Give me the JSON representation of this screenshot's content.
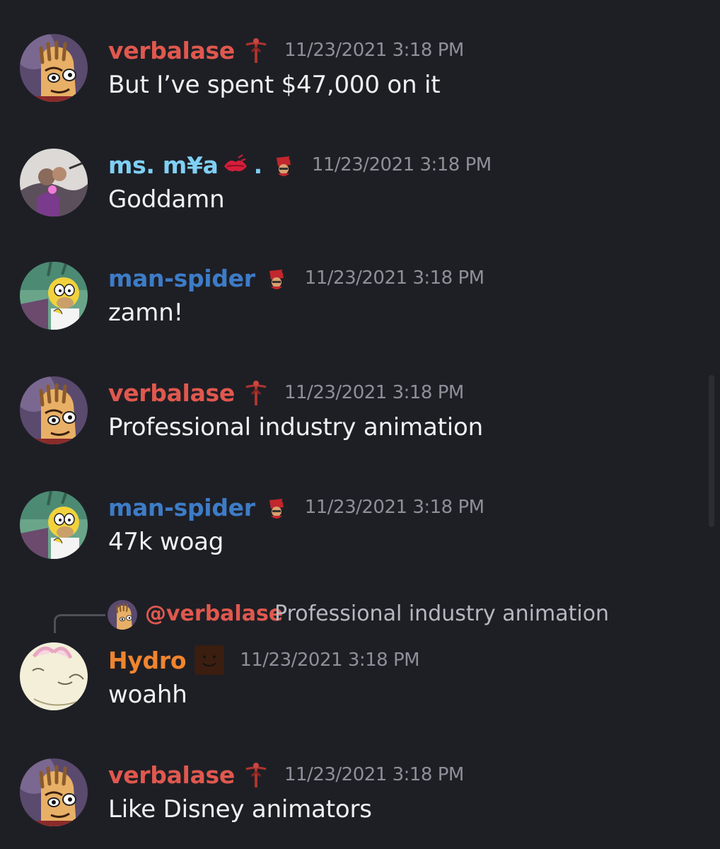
{
  "colors": {
    "background": "#1e1f25",
    "verbalase": "#e0584e",
    "mya": "#7fd0f5",
    "man_spider": "#3d7cc7",
    "hydro": "#f0842e",
    "timestamp": "#8d9099",
    "message_text": "#f0f1f3"
  },
  "messages": [
    {
      "username": "verbalase",
      "badge_icon": "cross-figure-icon",
      "timestamp": "11/23/2021 3:18 PM",
      "text": "But I’ve spent $47,000 on it"
    },
    {
      "username": "ms. m¥a",
      "username_suffix": ".",
      "badge_icon": "kiss-lips-icon",
      "badge2_icon": "fez-guy-icon",
      "timestamp": "11/23/2021 3:18 PM",
      "text": "Goddamn"
    },
    {
      "username": "man-spider",
      "badge_icon": "fez-guy-icon",
      "timestamp": "11/23/2021 3:18 PM",
      "text": "zamn!"
    },
    {
      "username": "verbalase",
      "badge_icon": "cross-figure-icon",
      "timestamp": "11/23/2021 3:18 PM",
      "text": "Professional industry animation"
    },
    {
      "username": "man-spider",
      "badge_icon": "fez-guy-icon",
      "timestamp": "11/23/2021 3:18 PM",
      "text": "47k woag"
    },
    {
      "reply": {
        "mention": "@verbalase",
        "text": "Professional industry animation"
      },
      "username": "Hydro",
      "badge_icon": "brown-smiley-icon",
      "timestamp": "11/23/2021 3:18 PM",
      "text": "woahh"
    },
    {
      "username": "verbalase",
      "badge_icon": "cross-figure-icon",
      "timestamp": "11/23/2021 3:18 PM",
      "text": "Like Disney animators"
    }
  ]
}
